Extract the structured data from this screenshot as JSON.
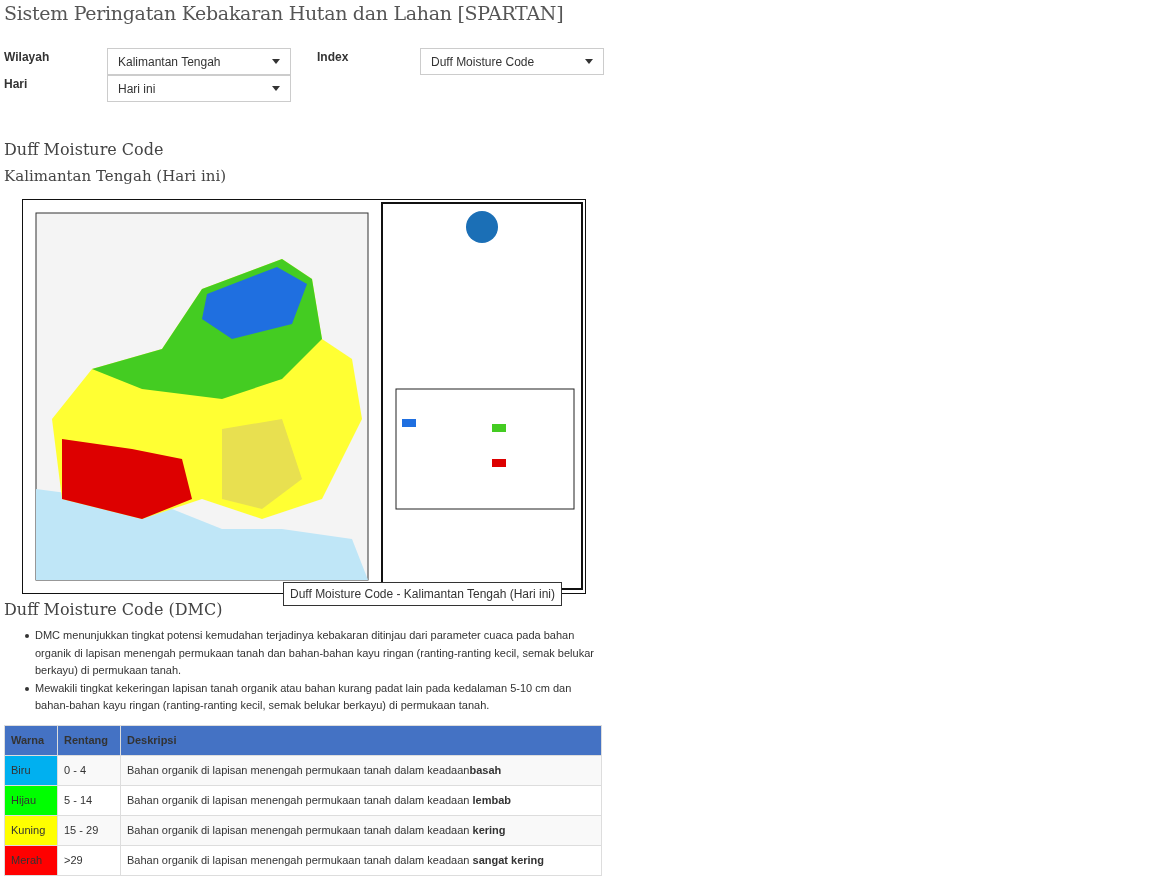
{
  "page_title": "Sistem Peringatan Kebakaran Hutan dan Lahan [SPARTAN]",
  "filters": [
    {
      "label": "Wilayah",
      "value": "Kalimantan Tengah"
    },
    {
      "label": "Index",
      "value": "Duff Moisture Code"
    },
    {
      "label": "Hari",
      "value": "Hari ini"
    }
  ],
  "map_section": {
    "title": "Duff Moisture Code",
    "subtitle": "Kalimantan Tengah (Hari ini)",
    "tooltip": "Duff Moisture Code - Kalimantan Tengah (Hari ini)"
  },
  "info": {
    "title": "Duff Moisture Code (DMC)",
    "bullets": [
      "DMC menunjukkan tingkat potensi kemudahan terjadinya kebakaran ditinjau dari parameter cuaca pada bahan organik di lapisan menengah permukaan tanah dan bahan-bahan kayu ringan (ranting-ranting kecil, semak belukar berkayu) di permukaan tanah.",
      "Mewakili tingkat kekeringan lapisan tanah organik atau bahan kurang padat lain pada kedalaman 5-10 cm dan bahan-bahan kayu ringan (ranting-ranting kecil, semak belukar berkayu) di permukaan tanah."
    ]
  },
  "table": {
    "columns": [
      "Warna",
      "Rentang",
      "Deskripsi"
    ],
    "rows": [
      {
        "warna": "Biru",
        "color": "#00b0f0",
        "rentang": "0 - 4",
        "deskripsi": "Bahan organik di lapisan menengah permukaan tanah dalam keadaan**basah**"
      },
      {
        "warna": "Hijau",
        "color": "#00ff00",
        "rentang": "5 - 14",
        "deskripsi": "Bahan organik di lapisan menengah permukaan tanah dalam keadaan **lembab**"
      },
      {
        "warna": "Kuning",
        "color": "#ffff00",
        "rentang": "15 - 29",
        "deskripsi": "Bahan organik di lapisan menengah permukaan tanah dalam keadaan **kering**"
      },
      {
        "warna": "Merah",
        "color": "#ff0000",
        "rentang": ">29",
        "deskripsi": "Bahan organik di lapisan menengah permukaan tanah dalam keadaan **sangat kering**"
      }
    ]
  }
}
